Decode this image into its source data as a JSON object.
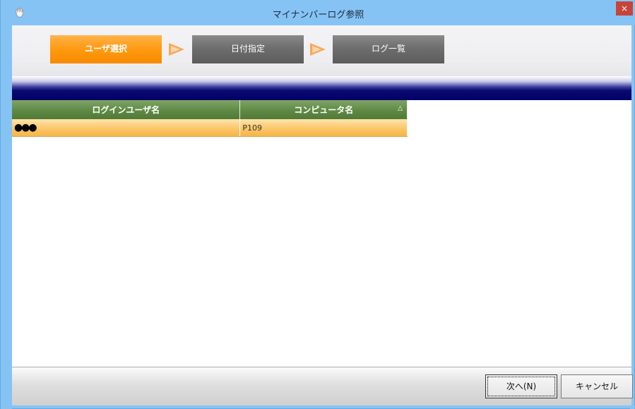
{
  "window": {
    "title": "マイナンバーログ参照",
    "close_label": "×"
  },
  "wizard": {
    "steps": [
      {
        "label": "ユーザ選択",
        "state": "active"
      },
      {
        "label": "日付指定",
        "state": "inactive"
      },
      {
        "label": "ログ一覧",
        "state": "inactive"
      }
    ]
  },
  "grid": {
    "columns": [
      "ログインユーザ名",
      "コンピュータ名"
    ],
    "sort_indicator": "△",
    "rows": [
      {
        "user": "●●●",
        "computer": "P109"
      }
    ]
  },
  "footer": {
    "next_label": "次へ(N)",
    "cancel_label": "キャンセル"
  },
  "colors": {
    "titlebar": "#86c3f5",
    "active_step": "#ff9a10",
    "inactive_step": "#6e6e6e",
    "header_band": "#000066",
    "grid_header": "#5f8a45",
    "selected_row": "#fbc463"
  }
}
